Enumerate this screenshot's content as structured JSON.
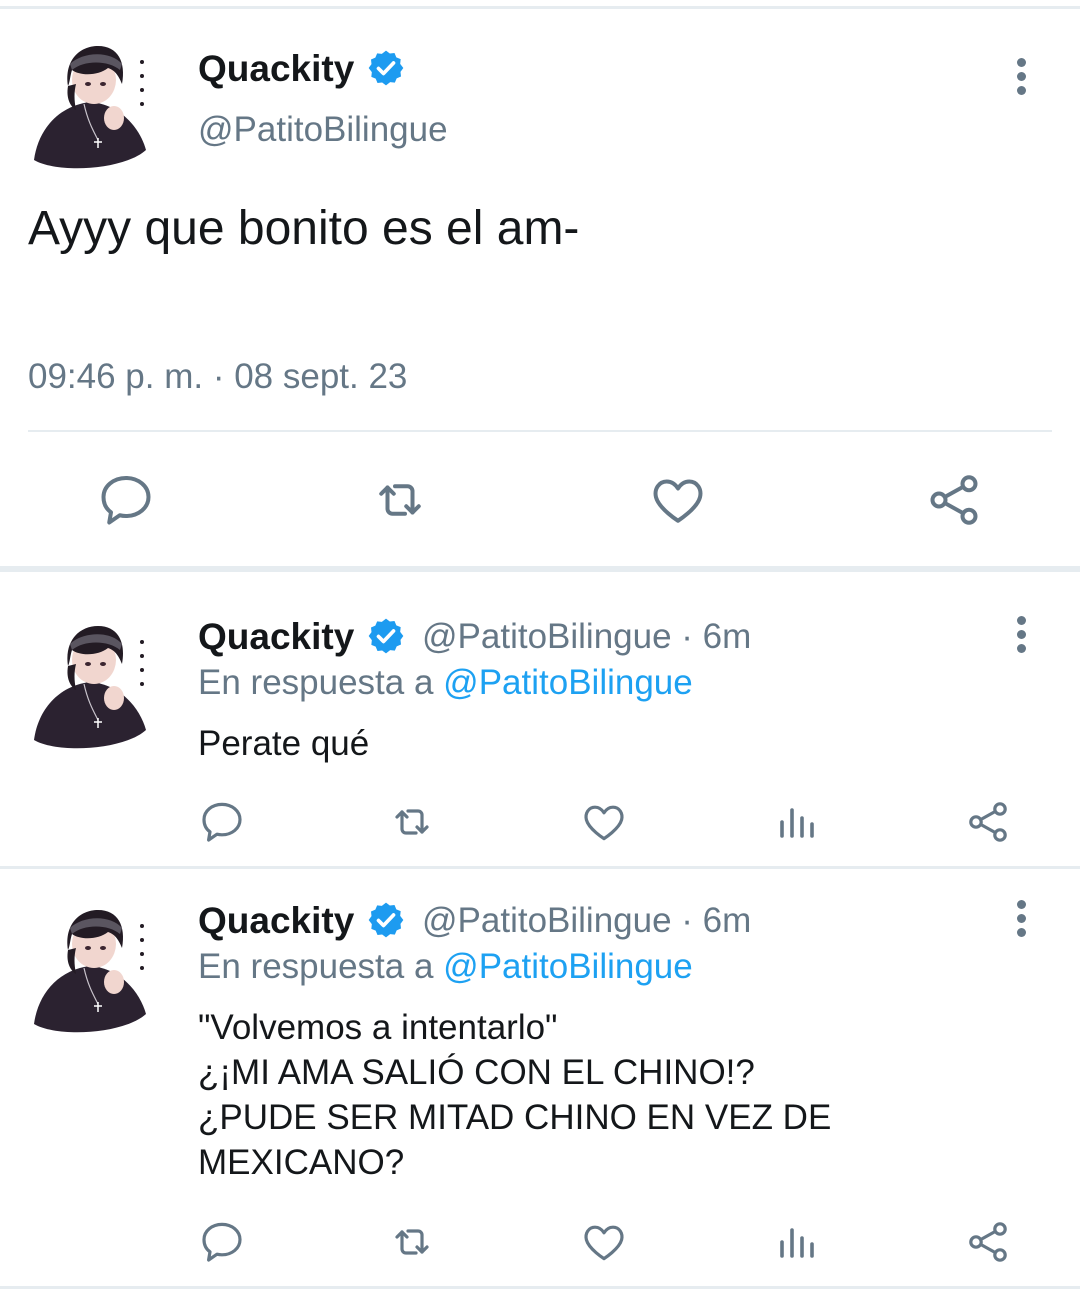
{
  "colors": {
    "text": "#14171a",
    "muted": "#657786",
    "link": "#1da1f2",
    "verified": "#1d9bf0",
    "divider": "#e6ecf0"
  },
  "main_tweet": {
    "display_name": "Quackity",
    "handle": "@PatitoBilingue",
    "text": "Ayyy que bonito es el am-",
    "timestamp": "09:46 p. m. · 08 sept. 23",
    "actions": [
      "reply-icon",
      "retweet-icon",
      "like-icon",
      "share-icon"
    ]
  },
  "replies": [
    {
      "display_name": "Quackity",
      "handle_time": "@PatitoBilingue · 6m",
      "reply_prefix": "En respuesta a",
      "reply_to": "@PatitoBilingue",
      "lines": [
        "Perate qué"
      ],
      "actions": [
        "reply-icon",
        "retweet-icon",
        "like-icon",
        "analytics-icon",
        "share-icon"
      ]
    },
    {
      "display_name": "Quackity",
      "handle_time": "@PatitoBilingue · 6m",
      "reply_prefix": "En respuesta a",
      "reply_to": "@PatitoBilingue",
      "lines": [
        "\"Volvemos a intentarlo\"",
        "¿¡MI AMA SALIÓ CON EL CHINO!?",
        "¿PUDE SER MITAD CHINO EN VEZ DE",
        "MEXICANO?"
      ],
      "actions": [
        "reply-icon",
        "retweet-icon",
        "like-icon",
        "analytics-icon",
        "share-icon"
      ]
    }
  ]
}
